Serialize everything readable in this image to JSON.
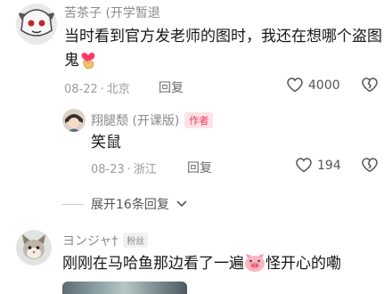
{
  "comments": [
    {
      "user": "苦茶子 (开学暂退",
      "text_before_emoji": "当时看到官方发老师的图时，我还在想哪个盗图鬼",
      "emoji_icon": "finger-heart-emoji",
      "date": "08-22",
      "location": "北京",
      "reply_label": "回复",
      "likes": "4000"
    },
    {
      "user": "翔腿颓 (开课版)",
      "badge": "作者",
      "text": "笑鼠",
      "date": "08-23",
      "location": "浙江",
      "reply_label": "回复",
      "likes": "194"
    },
    {
      "user": "ヨンジャ†",
      "badge": "粉丝",
      "text_before_emoji": "刚刚在马哈鱼那边看了一遍",
      "emoji_icon": "pig-face-emoji",
      "text_after_emoji": "怪开心的嘞"
    }
  ],
  "expand_replies_label": "展开16条回复",
  "colors": {
    "author_badge": "#f0365a",
    "meta": "#9b9b9b"
  }
}
